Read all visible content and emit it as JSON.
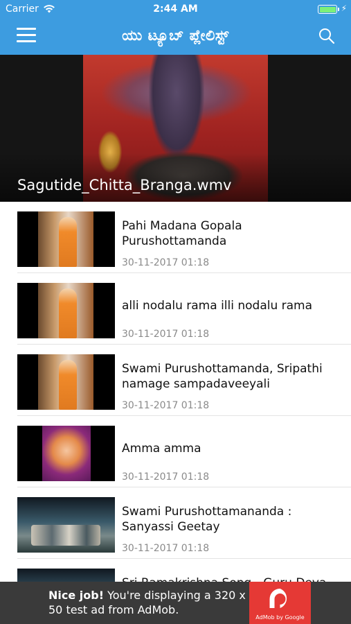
{
  "status_bar": {
    "carrier": "Carrier",
    "time": "2:44 AM",
    "battery_level": 1.0,
    "charging_icon": "bolt-icon",
    "wifi_icon": "wifi-icon"
  },
  "nav": {
    "title": "ಯು ಟ್ಯೂಬ್ ಪ್ಲೇಲಿಸ್ಟ್",
    "menu_icon": "hamburger-icon",
    "search_icon": "search-icon",
    "color": "#3d9ce0"
  },
  "featured": {
    "title": "Sagutide_Chitta_Branga.wmv"
  },
  "videos": [
    {
      "title": "Pahi Madana Gopala Purushottamanda",
      "date": "30-11-2017 01:18"
    },
    {
      "title": "alli nodalu rama illi nodalu rama",
      "date": "30-11-2017 01:18"
    },
    {
      "title": "Swami Purushottamanda, Sripathi namage sampadaveeyali",
      "date": "30-11-2017 01:18"
    },
    {
      "title": "Amma amma",
      "date": "30-11-2017 01:18"
    },
    {
      "title": "Swami Purushottamananda : Sanyassi Geetay",
      "date": "30-11-2017 01:18"
    },
    {
      "title": "Sri Ramakrishna Song - Guru Deva",
      "date": ""
    }
  ],
  "ad": {
    "headline": "Nice job!",
    "body": " You're displaying a 320 x 50 test ad from AdMob.",
    "logo_caption": "AdMob by Google",
    "logo_color": "#e53935"
  }
}
